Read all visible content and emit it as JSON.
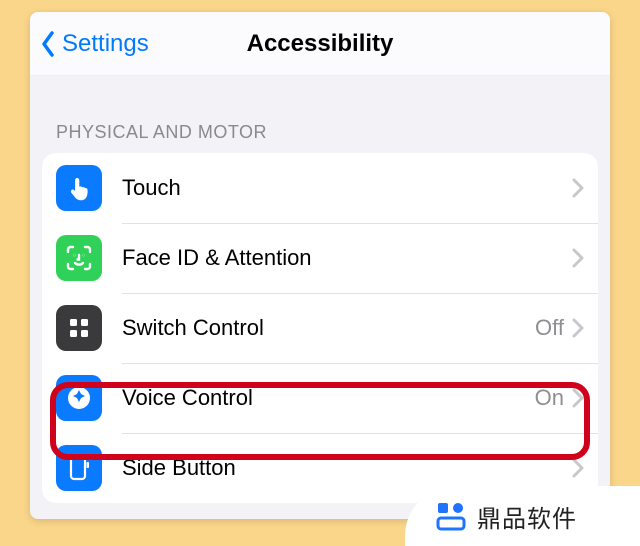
{
  "nav": {
    "back_label": "Settings",
    "title": "Accessibility"
  },
  "section_header": "PHYSICAL AND MOTOR",
  "rows": {
    "touch": {
      "label": "Touch"
    },
    "faceid": {
      "label": "Face ID & Attention"
    },
    "switch": {
      "label": "Switch Control",
      "status": "Off"
    },
    "voice": {
      "label": "Voice Control",
      "status": "On"
    },
    "side": {
      "label": "Side Button"
    }
  },
  "watermark": {
    "text": "鼎品软件"
  },
  "colors": {
    "accent": "#007aff",
    "highlight": "#d0021b",
    "frame": "#fad68a"
  }
}
